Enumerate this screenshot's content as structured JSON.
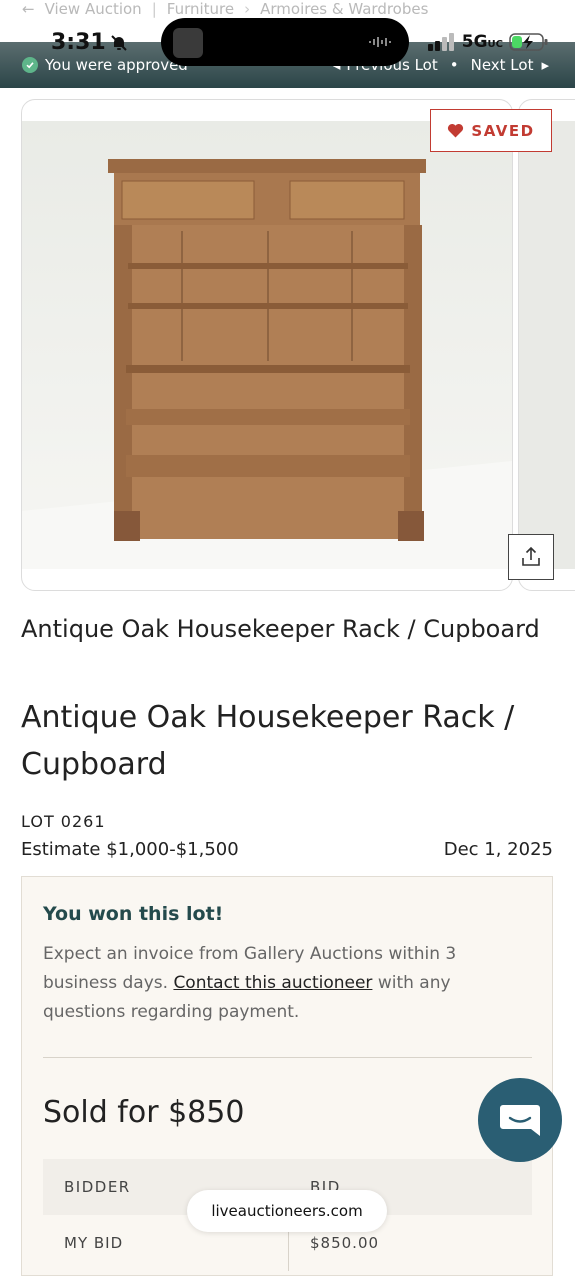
{
  "status_bar": {
    "time": "3:31",
    "network": "5G",
    "network_suffix": "UC"
  },
  "breadcrumb": {
    "back_label": "View Auction",
    "items": [
      "Furniture",
      "Armoires & Wardrobes"
    ]
  },
  "approval_bar": {
    "message": "You were approved",
    "prev_label": "Previous Lot",
    "next_label": "Next Lot",
    "separator": "•"
  },
  "gallery": {
    "saved_label": "SAVED",
    "share_icon": "share-icon"
  },
  "lot": {
    "title": "Antique Oak Housekeeper Rack / Cupboard",
    "number": "LOT 0261",
    "estimate": "Estimate $1,000-$1,500",
    "date": "Dec 1, 2025"
  },
  "won_panel": {
    "heading": "You won this lot!",
    "message_before": "Expect an invoice from Gallery Auctions within 3 business days. ",
    "contact_link": "Contact this auctioneer",
    "message_after": " with any questions regarding payment.",
    "sold_for": "Sold for $850",
    "table_headers": [
      "BIDDER",
      "BID"
    ],
    "rows": [
      {
        "bidder": "MY BID",
        "bid": "$850.00"
      }
    ]
  },
  "browser": {
    "url": "liveauctioneers.com"
  },
  "colors": {
    "accent_saved": "#c23b32",
    "won_heading": "#244a4c",
    "chat_fab": "#2a5e73"
  }
}
